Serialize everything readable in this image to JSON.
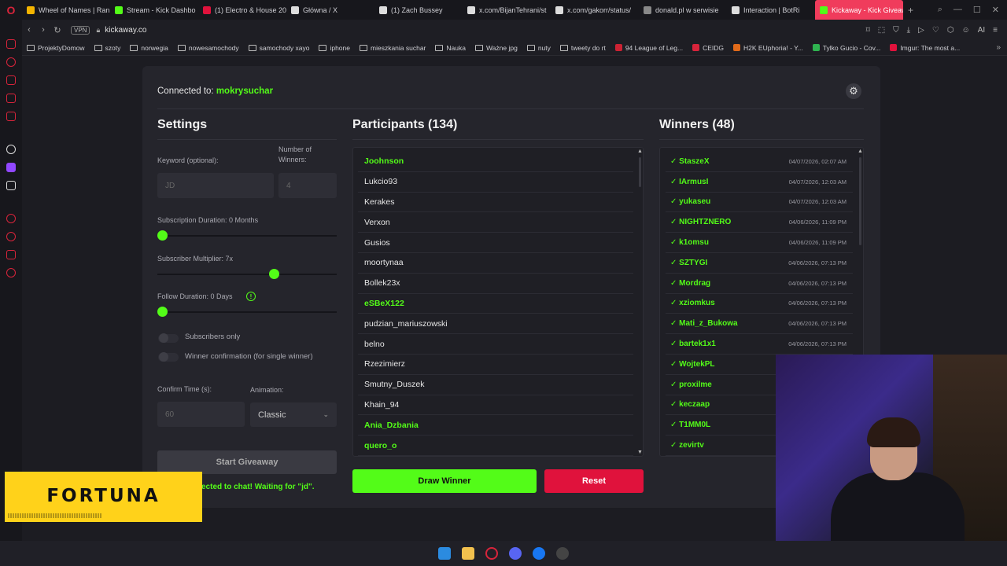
{
  "browser": {
    "tabs": [
      {
        "label": "Wheel of Names | Ran",
        "color": "#f4b400"
      },
      {
        "label": "Stream - Kick Dashbo",
        "color": "#53fc18"
      },
      {
        "label": "(1) Electro & House 20",
        "color": "#e0123c"
      },
      {
        "label": "Główna / X",
        "color": "#dddddd"
      },
      {
        "label": "(1) Zach Bussey",
        "color": "#dddddd"
      },
      {
        "label": "x.com/BijanTehrani/st",
        "color": "#dddddd"
      },
      {
        "label": "x.com/gakorr/status/",
        "color": "#dddddd"
      },
      {
        "label": "donald.pl w serwisie",
        "color": "#888888"
      },
      {
        "label": "Interaction | BotRi",
        "color": "#dddddd"
      },
      {
        "label": "Kickaway - Kick Giveaway",
        "color": "#53fc18"
      }
    ],
    "new_tab": "+",
    "address": {
      "vpn": "VPN",
      "url": "kickaway.co"
    },
    "bookmarks": [
      {
        "label": "ProjektyDomow",
        "kind": "folder"
      },
      {
        "label": "szoty",
        "kind": "folder"
      },
      {
        "label": "norwegia",
        "kind": "folder"
      },
      {
        "label": "nowesamochody",
        "kind": "folder"
      },
      {
        "label": "samochody xayo",
        "kind": "folder"
      },
      {
        "label": "iphone",
        "kind": "folder"
      },
      {
        "label": "mieszkania suchar",
        "kind": "folder"
      },
      {
        "label": "Nauka",
        "kind": "folder"
      },
      {
        "label": "Ważne jpg",
        "kind": "folder"
      },
      {
        "label": "nuty",
        "kind": "folder"
      },
      {
        "label": "tweety do rt",
        "kind": "folder"
      },
      {
        "label": "94 League of Leg...",
        "kind": "site"
      },
      {
        "label": "CEIDG",
        "kind": "site"
      },
      {
        "label": "H2K EUphoria! - Y...",
        "kind": "site"
      },
      {
        "label": "Tylko Gucio - Cov...",
        "kind": "site"
      },
      {
        "label": "Imgur: The most a...",
        "kind": "site"
      }
    ],
    "bookmarks_more": "»"
  },
  "app": {
    "connected_prefix": "Connected to:",
    "channel": "mokrysuchar",
    "settings": {
      "title": "Settings",
      "keyword_label": "Keyword (optional):",
      "keyword_value": "JD",
      "winners_label": "Number of Winners:",
      "winners_value": "4",
      "sub_duration_label": "Subscription Duration: 0 Months",
      "sub_duration_value": 0,
      "sub_multiplier_label": "Subscriber Multiplier: 7x",
      "sub_multiplier_value": 0.66,
      "follow_label": "Follow Duration:  0  Days",
      "follow_value": 0,
      "info_icon": "!",
      "subs_only_label": "Subscribers only",
      "confirm_label": "Winner confirmation (for single winner)",
      "confirm_time_label": "Confirm Time (s):",
      "confirm_time_value": "60",
      "animation_label": "Animation:",
      "animation_value": "Classic",
      "start_button": "Start Giveaway",
      "status": "ected to chat! Waiting for \"jd\"."
    },
    "participants": {
      "title": "Participants (134)",
      "items": [
        {
          "name": "Joohnson",
          "green": true
        },
        {
          "name": "Lukcio93",
          "green": false
        },
        {
          "name": "Kerakes",
          "green": false
        },
        {
          "name": "Verxon",
          "green": false
        },
        {
          "name": "Gusios",
          "green": false
        },
        {
          "name": "moortynaa",
          "green": false
        },
        {
          "name": "Bollek23x",
          "green": false
        },
        {
          "name": "eSBeX122",
          "green": true
        },
        {
          "name": "pudzian_mariuszowski",
          "green": false
        },
        {
          "name": "belno",
          "green": false
        },
        {
          "name": "Rzezimierz",
          "green": false
        },
        {
          "name": "Smutny_Duszek",
          "green": false
        },
        {
          "name": "Khain_94",
          "green": false
        },
        {
          "name": "Ania_Dzbania",
          "green": true
        },
        {
          "name": "quero_o",
          "green": true
        }
      ]
    },
    "winners": {
      "title": "Winners (48)",
      "items": [
        {
          "name": "✓ StaszeX",
          "date": "04/07/2026, 02:07 AM"
        },
        {
          "name": "✓ IArmusI",
          "date": "04/07/2026, 12:03 AM"
        },
        {
          "name": "✓ yukaseu",
          "date": "04/07/2026, 12:03 AM"
        },
        {
          "name": "✓ NIGHTZNERO",
          "date": "04/06/2026, 11:09 PM"
        },
        {
          "name": "✓ k1omsu",
          "date": "04/06/2026, 11:09 PM"
        },
        {
          "name": "✓ SZTYGI",
          "date": "04/06/2026, 07:13 PM"
        },
        {
          "name": "✓ Mordrag",
          "date": "04/06/2026, 07:13 PM"
        },
        {
          "name": "✓ xziomkus",
          "date": "04/06/2026, 07:13 PM"
        },
        {
          "name": "✓ Mati_z_Bukowa",
          "date": "04/06/2026, 07:13 PM"
        },
        {
          "name": "✓ bartek1x1",
          "date": "04/06/2026, 07:13 PM"
        },
        {
          "name": "✓ WojtekPL",
          "date": ""
        },
        {
          "name": "✓ proxilme",
          "date": ""
        },
        {
          "name": "✓ keczaap",
          "date": ""
        },
        {
          "name": "✓ T1MM0L",
          "date": ""
        },
        {
          "name": "✓ zevirtv",
          "date": ""
        }
      ]
    },
    "draw_button": "Draw Winner",
    "reset_button": "Reset"
  },
  "overlay": {
    "sponsor": "FORTUNA"
  },
  "colors": {
    "accent": "#53fc18",
    "danger": "#e0123c"
  }
}
